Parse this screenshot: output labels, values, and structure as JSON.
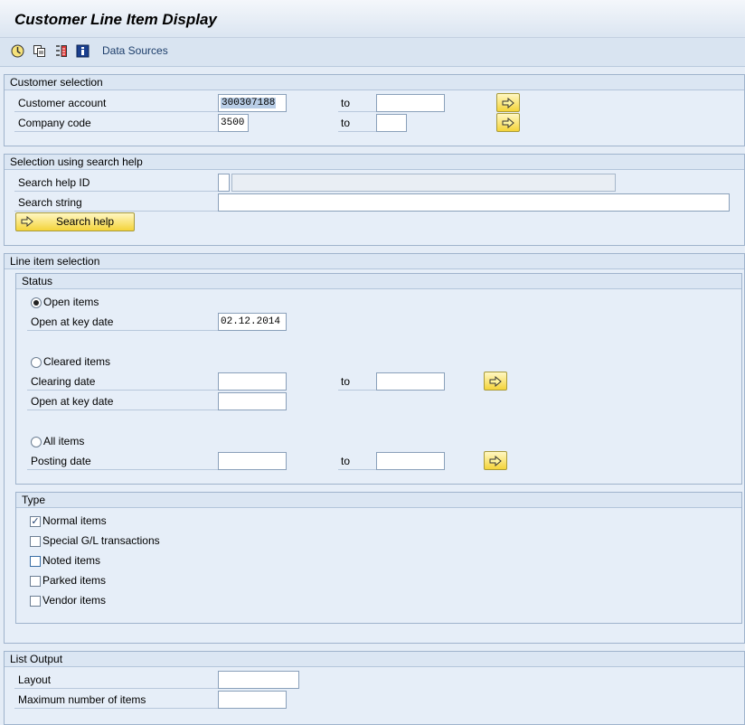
{
  "header": {
    "title": "Customer Line Item Display"
  },
  "toolbar": {
    "icons": [
      "execute-icon",
      "get-variant-icon",
      "selection-options-icon",
      "info-icon"
    ],
    "data_sources_label": "Data Sources"
  },
  "customer_selection": {
    "title": "Customer selection",
    "customer_account_label": "Customer account",
    "customer_account_value": "300307188",
    "company_code_label": "Company code",
    "company_code_value": "3500",
    "to_label": "to"
  },
  "search_help": {
    "title": "Selection using search help",
    "search_help_id_label": "Search help ID",
    "search_string_label": "Search string",
    "button_label": "Search help"
  },
  "line_item": {
    "title": "Line item selection",
    "status": {
      "title": "Status",
      "open_items_label": "Open items",
      "open_key_date_label": "Open at key date",
      "open_key_date_value": "02.12.2014",
      "cleared_items_label": "Cleared items",
      "clearing_date_label": "Clearing date",
      "cleared_key_date_label": "Open at key date",
      "all_items_label": "All items",
      "posting_date_label": "Posting date",
      "to_label": "to",
      "selected": "open"
    },
    "type": {
      "title": "Type",
      "items": [
        {
          "label": "Normal items",
          "checked": true
        },
        {
          "label": "Special G/L transactions",
          "checked": false
        },
        {
          "label": "Noted items",
          "checked": false
        },
        {
          "label": "Parked items",
          "checked": false
        },
        {
          "label": "Vendor items",
          "checked": false
        }
      ]
    }
  },
  "list_output": {
    "title": "List Output",
    "layout_label": "Layout",
    "max_items_label": "Maximum number of items"
  },
  "colors": {
    "accent_button": "#f4d43a",
    "background": "#e4ecf6"
  }
}
